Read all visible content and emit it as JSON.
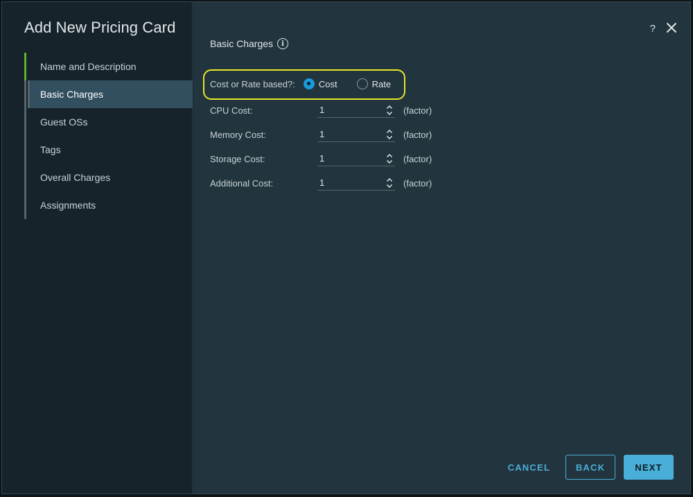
{
  "wizard": {
    "title": "Add New Pricing Card",
    "steps": [
      {
        "label": "Name and Description",
        "state": "complete"
      },
      {
        "label": "Basic Charges",
        "state": "active"
      },
      {
        "label": "Guest OSs",
        "state": "pending"
      },
      {
        "label": "Tags",
        "state": "pending"
      },
      {
        "label": "Overall Charges",
        "state": "pending"
      },
      {
        "label": "Assignments",
        "state": "pending"
      }
    ]
  },
  "header": {
    "help_label": "?",
    "close_icon": "close-icon"
  },
  "section": {
    "title": "Basic Charges",
    "info_icon": "info-icon",
    "info_glyph": "i"
  },
  "cost_mode": {
    "label": "Cost or Rate based?:",
    "options": [
      {
        "label": "Cost",
        "checked": true
      },
      {
        "label": "Rate",
        "checked": false
      }
    ]
  },
  "fields": [
    {
      "label": "CPU Cost:",
      "value": "1",
      "unit": "(factor)"
    },
    {
      "label": "Memory Cost:",
      "value": "1",
      "unit": "(factor)"
    },
    {
      "label": "Storage Cost:",
      "value": "1",
      "unit": "(factor)"
    },
    {
      "label": "Additional Cost:",
      "value": "1",
      "unit": "(factor)"
    }
  ],
  "footer": {
    "cancel": "CANCEL",
    "back": "BACK",
    "next": "NEXT"
  },
  "colors": {
    "accent": "#49afd9",
    "radio_selected": "#1a9ad8",
    "step_complete": "#5fb32d",
    "highlight": "#e8e82a"
  }
}
